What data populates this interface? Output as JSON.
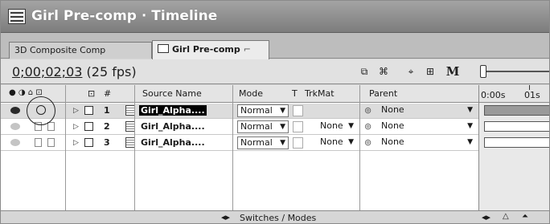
{
  "window": {
    "title": "Girl Pre-comp · Timeline"
  },
  "tabs": [
    {
      "label": "3D Composite Comp",
      "active": false
    },
    {
      "label": "Girl Pre-comp",
      "active": true
    }
  ],
  "controls": {
    "timecode": "0;00;02;03",
    "fps": "(25 fps)",
    "m_label": "M"
  },
  "columns": {
    "number": "#",
    "source_name": "Source Name",
    "mode": "Mode",
    "t": "T",
    "trkmat": "TrkMat",
    "parent": "Parent"
  },
  "layers": [
    {
      "number": "1",
      "name": "Girl_Alpha....",
      "mode": "Normal",
      "trkmat": "",
      "parent": "None",
      "selected": true
    },
    {
      "number": "2",
      "name": "Girl_Alpha....",
      "mode": "Normal",
      "trkmat": "None",
      "parent": "None",
      "selected": false
    },
    {
      "number": "3",
      "name": "Girl_Alpha....",
      "mode": "Normal",
      "trkmat": "None",
      "parent": "None",
      "selected": false
    }
  ],
  "ruler": {
    "start": "0:00s",
    "next": "01s"
  },
  "bottom": {
    "switches_label": "Switches / Modes"
  },
  "icons": {
    "app": "timeline-window-icon",
    "comp_tab": "composition-icon",
    "eye": "eye-icon",
    "lock": "lock-icon",
    "layer": "footage-icon",
    "parent": "pickwhip-icon"
  },
  "colors": {
    "title_bar": "#7d7d7d",
    "selected_row": "#dcdcdc",
    "layer_bar": "#9a9a9a"
  }
}
